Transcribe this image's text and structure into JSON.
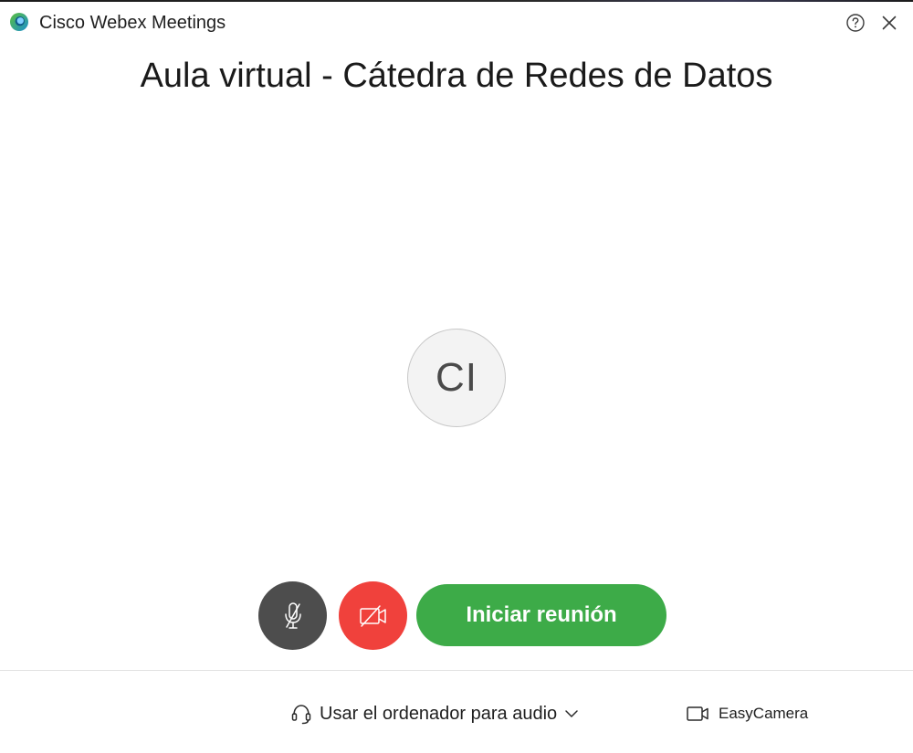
{
  "window": {
    "app_title": "Cisco Webex Meetings"
  },
  "meeting": {
    "title": "Aula virtual - Cátedra de Redes de Datos",
    "avatar_initials": "CI"
  },
  "controls": {
    "start_label": "Iniciar reunión",
    "mute_icon": "microphone-muted-icon",
    "video_icon": "video-off-icon"
  },
  "footer": {
    "audio_label": "Usar el ordenador para audio",
    "camera_label": "EasyCamera"
  },
  "colors": {
    "start_green": "#3dab48",
    "video_red": "#f0413c",
    "mute_gray": "#4d4d4d",
    "logo_blue": "#1a8fd1",
    "logo_green": "#5bbf3a"
  }
}
